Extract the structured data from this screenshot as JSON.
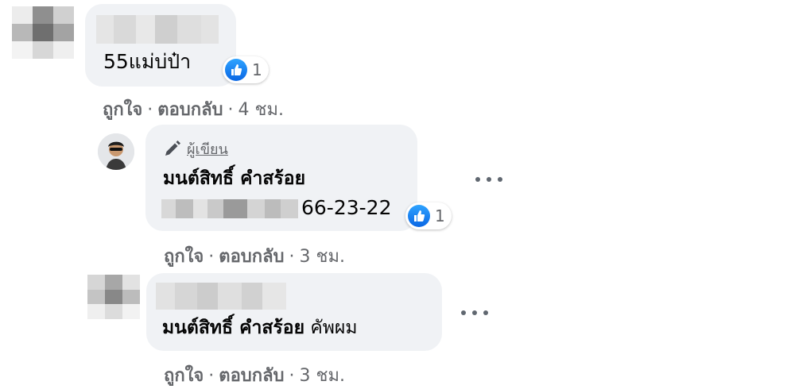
{
  "comments": [
    {
      "author": "",
      "text": "55แม่บ่ป๋า",
      "reactions": "1",
      "actions": {
        "like": "ถูกใจ",
        "reply": "ตอบกลับ",
        "time": "4 ชม."
      }
    },
    {
      "badge": "ผู้เขียน",
      "author": "มนต์สิทธิ์ คำสร้อย",
      "text": "66-23-22",
      "reactions": "1",
      "actions": {
        "like": "ถูกใจ",
        "reply": "ตอบกลับ",
        "time": "3 ชม."
      }
    },
    {
      "author": "",
      "mention": "มนต์สิทธิ์ คำสร้อย",
      "text": "คัพผม",
      "actions": {
        "like": "ถูกใจ",
        "reply": "ตอบกลับ",
        "time": "3 ชม."
      }
    }
  ],
  "colors": {
    "bubble": "#f0f2f5",
    "like": "#1877f2",
    "meta": "#65676b"
  }
}
